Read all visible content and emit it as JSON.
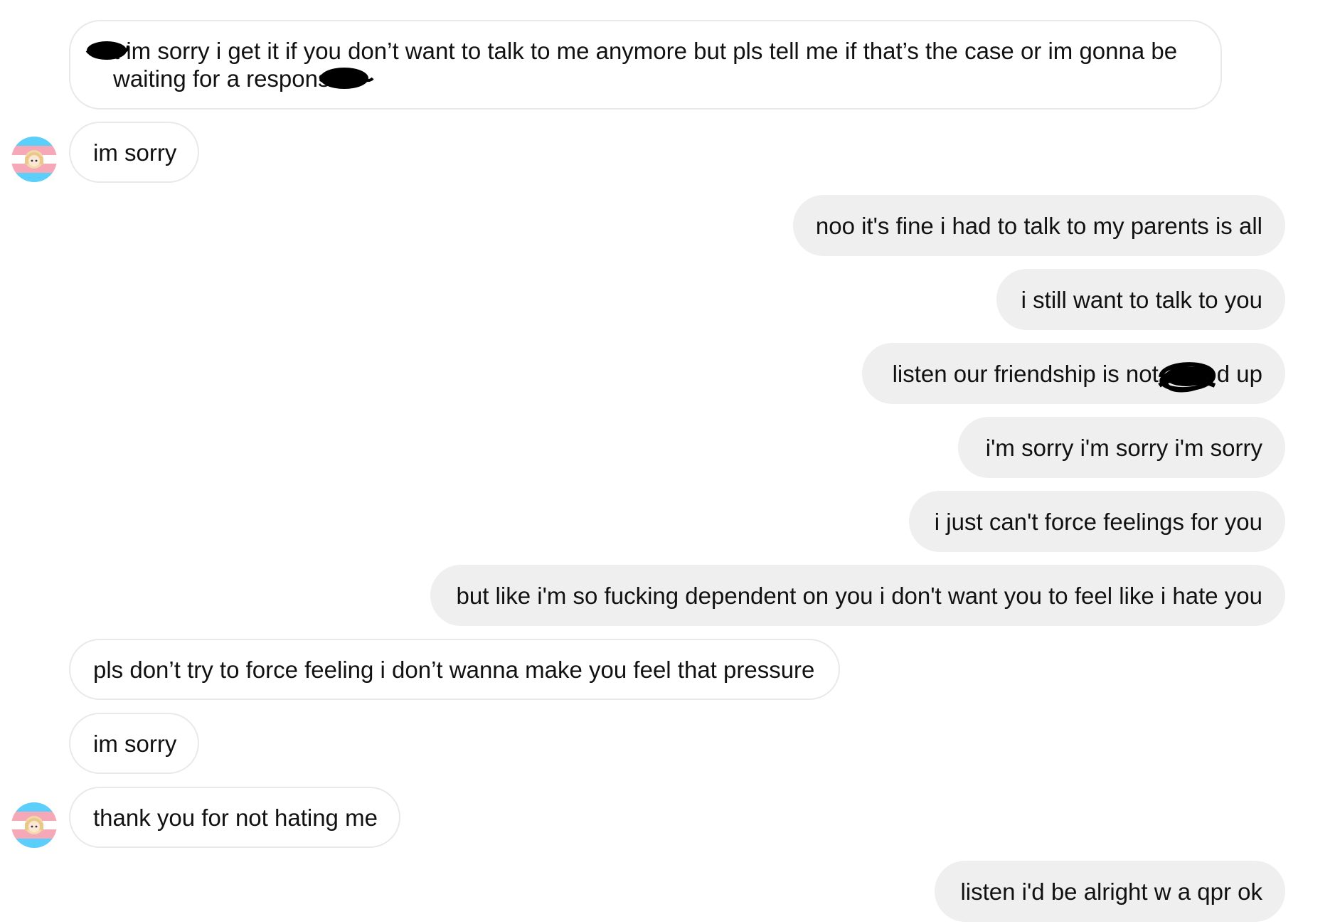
{
  "messages": [
    {
      "side": "incoming",
      "text": "t im sorry i get it if you don’t want to talk to me anymore but pls tell me if that’s the case or im gonna be waiting for a response"
    },
    {
      "side": "incoming",
      "text": "im sorry"
    },
    {
      "side": "outgoing",
      "text": "noo it's fine i had to talk to my parents is all"
    },
    {
      "side": "outgoing",
      "text": "i still want to talk to you"
    },
    {
      "side": "outgoing",
      "text": "listen our friendship is not",
      "text_end": "d up"
    },
    {
      "side": "outgoing",
      "text": "i'm sorry i'm sorry i'm sorry"
    },
    {
      "side": "outgoing",
      "text": "i just can't force feelings for you"
    },
    {
      "side": "outgoing",
      "text": "but like i'm so fucking dependent on you i don't want you to feel like i hate you"
    },
    {
      "side": "incoming",
      "text": "pls don’t try to force feeling i don’t wanna make you feel that pressure"
    },
    {
      "side": "incoming",
      "text": "im sorry"
    },
    {
      "side": "incoming",
      "text": "thank you for not hating me"
    },
    {
      "side": "outgoing",
      "text": "listen i'd be alright w a qpr ok"
    }
  ],
  "avatar": {
    "icon": "trans-flag-avatar-icon",
    "colors": [
      "#5BCEFA",
      "#F5A9B8",
      "#FFFFFF"
    ]
  },
  "colors": {
    "incoming_bg": "#ffffff",
    "incoming_border": "#e9e9e9",
    "outgoing_bg": "#efefef",
    "redaction": "#000000"
  }
}
